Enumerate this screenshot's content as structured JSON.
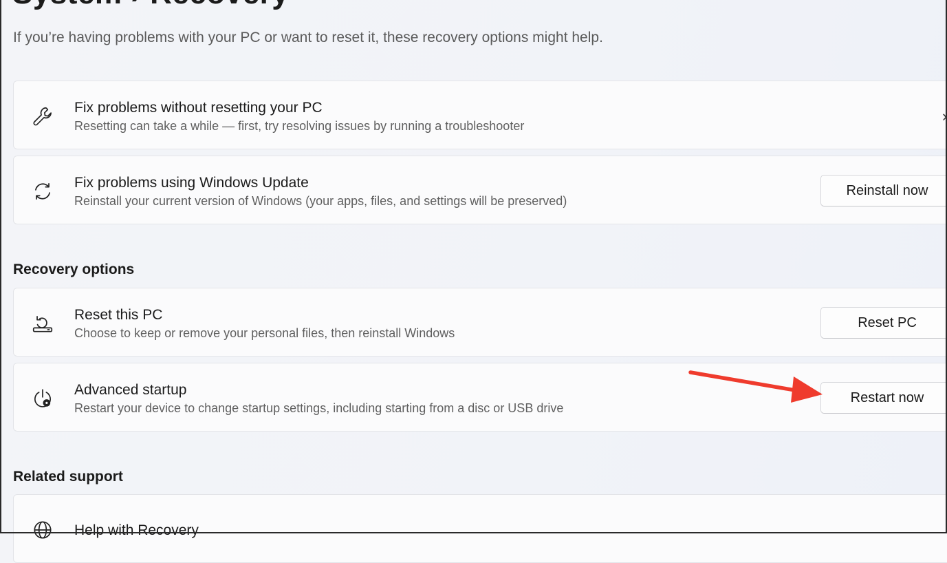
{
  "header": {
    "subtitle": "If you’re having problems with your PC or want to reset it, these recovery options might help."
  },
  "top_cards": [
    {
      "title": "Fix problems without resetting your PC",
      "description": "Resetting can take a while — first, try resolving issues by running a troubleshooter",
      "icon": "wrench-icon",
      "action": "chevron-right-icon"
    },
    {
      "title": "Fix problems using Windows Update",
      "description": "Reinstall your current version of Windows (your apps, files, and settings will be preserved)",
      "icon": "sync-icon",
      "button": "Reinstall now"
    }
  ],
  "recovery": {
    "heading": "Recovery options",
    "items": [
      {
        "title": "Reset this PC",
        "description": "Choose to keep or remove your personal files, then reinstall Windows",
        "icon": "reset-pc-icon",
        "button": "Reset PC"
      },
      {
        "title": "Advanced startup",
        "description": "Restart your device to change startup settings, including starting from a disc or USB drive",
        "icon": "power-gear-icon",
        "button": "Restart now"
      }
    ]
  },
  "related": {
    "heading": "Related support",
    "items": [
      {
        "title": "Help with Recovery",
        "icon": "globe-icon"
      }
    ]
  },
  "annotation": {
    "arrow_color": "#ef3b2d",
    "points_to": "Restart now"
  }
}
